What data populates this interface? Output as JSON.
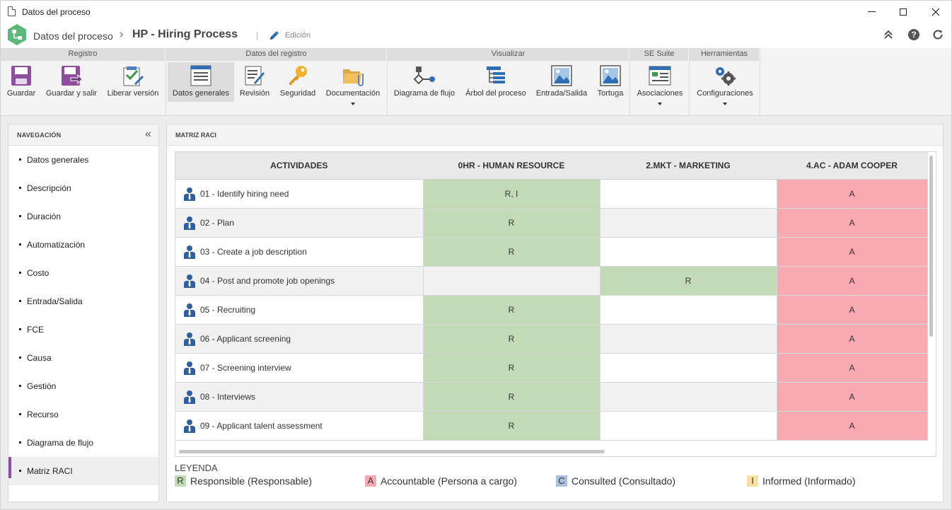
{
  "window": {
    "title": "Datos del proceso"
  },
  "header": {
    "crumb_root": "Datos del proceso",
    "crumb_sep": "›",
    "crumb_current": "HP - Hiring Process",
    "divider": "|",
    "mode_label": "Edición"
  },
  "ribbon": {
    "groups": [
      {
        "title": "Registro"
      },
      {
        "title": "Datos del registro"
      },
      {
        "title": "Visualizar"
      },
      {
        "title": "SE Suite"
      },
      {
        "title": "Herramientas"
      }
    ],
    "buttons": {
      "guardar": "Guardar",
      "guardar_salir": "Guardar y salir",
      "liberar": "Liberar versión",
      "datos_generales": "Datos generales",
      "revision": "Revisión",
      "seguridad": "Seguridad",
      "documentacion": "Documentación",
      "diagrama": "Diagrama de flujo",
      "arbol": "Árbol del proceso",
      "entrada_salida": "Entrada/Salida",
      "tortuga": "Tortuga",
      "asociaciones": "Asociaciones",
      "configuraciones": "Configuraciones"
    }
  },
  "nav": {
    "title": "NAVEGACIÓN",
    "collapse": "«",
    "items": [
      {
        "label": "Datos generales"
      },
      {
        "label": "Descripción"
      },
      {
        "label": "Duración"
      },
      {
        "label": "Automatización"
      },
      {
        "label": "Costo"
      },
      {
        "label": "Entrada/Salida"
      },
      {
        "label": "FCE"
      },
      {
        "label": "Causa"
      },
      {
        "label": "Gestión"
      },
      {
        "label": "Recurso"
      },
      {
        "label": "Diagrama de flujo"
      },
      {
        "label": "Matriz RACI"
      }
    ]
  },
  "main": {
    "title": "MATRIZ RACI",
    "columns": [
      "ACTIVIDADES",
      "0HR - HUMAN RESOURCE",
      "2.MKT - MARKETING",
      "4.AC - ADAM COOPER"
    ],
    "rows": [
      {
        "activity": "01 - Identify hiring need",
        "c1": "R, I",
        "c2": "",
        "c3": "A"
      },
      {
        "activity": "02 - Plan",
        "c1": "R",
        "c2": "",
        "c3": "A"
      },
      {
        "activity": "03 - Create a job description",
        "c1": "R",
        "c2": "",
        "c3": "A"
      },
      {
        "activity": "04 - Post and promote job openings",
        "c1": "",
        "c2": "R",
        "c3": "A"
      },
      {
        "activity": "05 - Recruiting",
        "c1": "R",
        "c2": "",
        "c3": "A"
      },
      {
        "activity": "06 - Applicant screening",
        "c1": "R",
        "c2": "",
        "c3": "A"
      },
      {
        "activity": "07 - Screening interview",
        "c1": "R",
        "c2": "",
        "c3": "A"
      },
      {
        "activity": "08 - Interviews",
        "c1": "R",
        "c2": "",
        "c3": "A"
      },
      {
        "activity": "09 - Applicant talent assessment",
        "c1": "R",
        "c2": "",
        "c3": "A"
      }
    ],
    "legend": {
      "title": "LEYENDA",
      "items": [
        {
          "key": "R",
          "label": "Responsible (Responsable)",
          "color": "#c2dbb6"
        },
        {
          "key": "A",
          "label": "Accountable (Persona a cargo)",
          "color": "#f7aab2"
        },
        {
          "key": "C",
          "label": "Consulted (Consultado)",
          "color": "#a9c1dc"
        },
        {
          "key": "I",
          "label": "Informed (Informado)",
          "color": "#f8e0a0"
        }
      ]
    }
  }
}
